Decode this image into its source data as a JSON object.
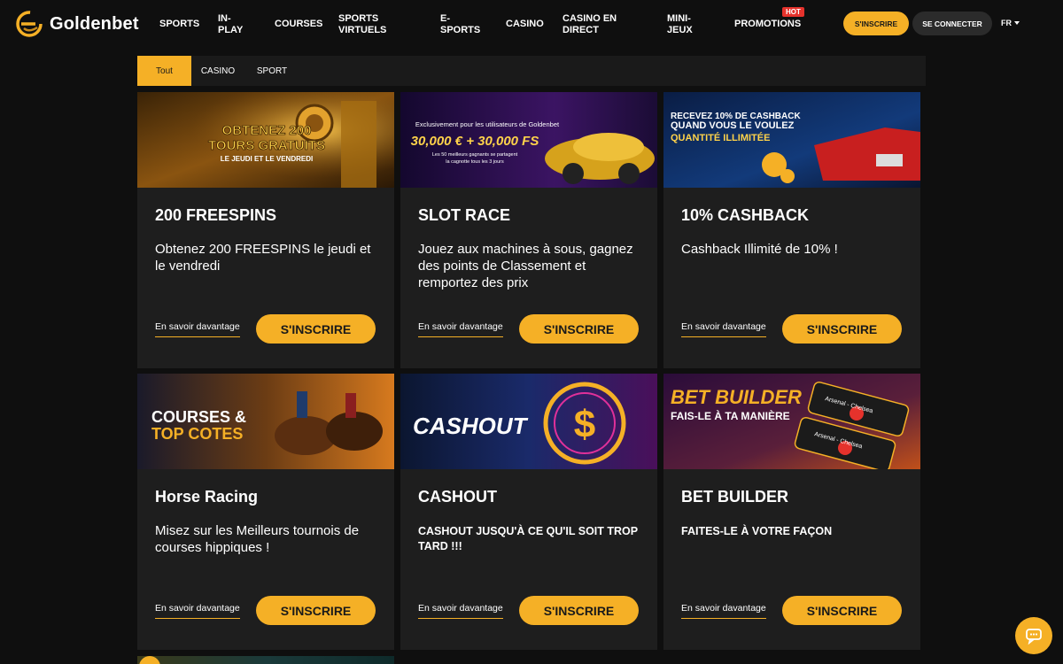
{
  "brand": {
    "name": "Goldenbet"
  },
  "nav": {
    "items": [
      "SPORTS",
      "IN-PLAY",
      "COURSES",
      "SPORTS VIRTUELS",
      "E-SPORTS",
      "CASINO",
      "CASINO EN DIRECT",
      "MINI-JEUX",
      "PROMOTIONS"
    ],
    "hot_badge": "HOT",
    "register": "S'INSCRIRE",
    "login": "SE CONNECTER",
    "language": "FR"
  },
  "filters": {
    "tabs": [
      "Tout",
      "CASINO",
      "SPORT"
    ],
    "active": "Tout"
  },
  "cards": [
    {
      "banner": [
        "OBTENEZ 200",
        "TOURS GRATUITS",
        "LE JEUDI ET LE VENDREDI"
      ],
      "title": "200 FREESPINS",
      "desc": "Obtenez 200 FREESPINS le jeudi et le vendredi",
      "learn": "En savoir davantage",
      "cta": "S'INSCRIRE"
    },
    {
      "banner": [
        "Exclusivement pour les utilisateurs de Goldenbet",
        "30,000 € + 30,000 FS",
        "Les 50 meilleurs gagnants se partagent",
        "la cagnotte tous les 3 jours"
      ],
      "title": "SLOT RACE",
      "desc": "Jouez aux machines à sous, gagnez des points de Classement et remportez des prix",
      "learn": "En savoir davantage",
      "cta": "S'INSCRIRE"
    },
    {
      "banner": [
        "RECEVEZ 10% DE CASHBACK",
        "QUAND VOUS LE VOULEZ",
        "QUANTITÉ ILLIMITÉE"
      ],
      "title": "10% CASHBACK",
      "desc": "Cashback Illimité de 10% !",
      "learn": "En savoir davantage",
      "cta": "S'INSCRIRE"
    },
    {
      "banner": [
        "COURSES &",
        "TOP COTES"
      ],
      "title": "Horse Racing",
      "desc": "Misez sur les Meilleurs tournois de courses hippiques !",
      "learn": "En savoir davantage",
      "cta": "S'INSCRIRE"
    },
    {
      "banner": [
        "CASHOUT"
      ],
      "title": "CASHOUT",
      "desc": "CASHOUT JUSQU'À CE QU'IL SOIT TROP TARD !!!",
      "learn": "En savoir davantage",
      "cta": "S'INSCRIRE"
    },
    {
      "banner": [
        "BET BUILDER",
        "FAIS-LE À TA MANIÈRE",
        "Arsenal - Chelsea",
        "Arsenal - Chelsea"
      ],
      "title": "BET BUILDER",
      "desc": "FAITES-LE À VOTRE FAÇON",
      "learn": "En savoir davantage",
      "cta": "S'INSCRIRE"
    }
  ]
}
